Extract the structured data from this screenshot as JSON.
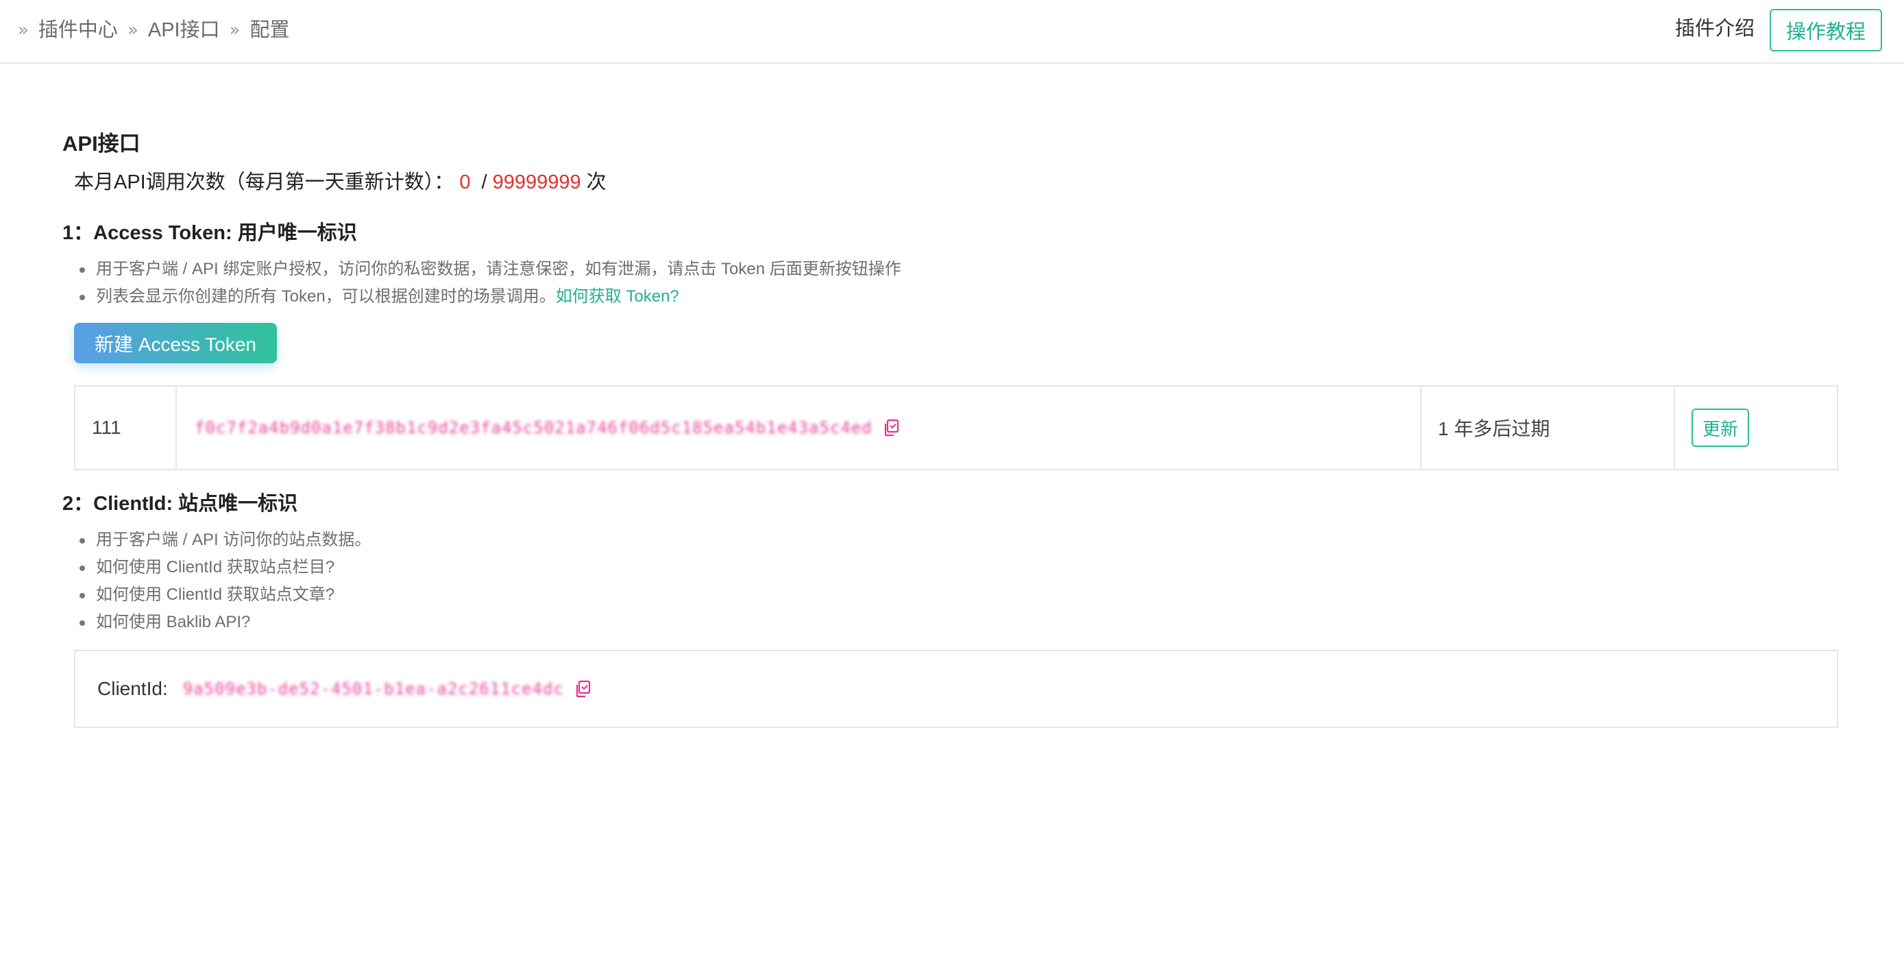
{
  "breadcrumb": {
    "items": [
      "插件中心",
      "API接口",
      "配置"
    ]
  },
  "header": {
    "intro_label": "插件介绍",
    "tutorial_label": "操作教程"
  },
  "page": {
    "title": "API接口",
    "quota": {
      "label": "本月API调用次数（每月第一天重新计数）：",
      "used": "0",
      "separator": "/",
      "limit": "99999999",
      "unit": "次"
    }
  },
  "access_token": {
    "title": "1：Access Token: 用户唯一标识",
    "bullets": [
      "用于客户端 / API 绑定账户授权，访问你的私密数据，请注意保密，如有泄漏，请点击 Token 后面更新按钮操作",
      "列表会显示你创建的所有 Token，可以根据创建时的场景调用。"
    ],
    "how_to_link": "如何获取 Token?",
    "new_button_label": "新建 Access Token",
    "rows": [
      {
        "name": "111",
        "token_masked": "f0c7f2a4b9d0a1e7f38b1c9d2e3fa45c5021a746f06d5c185ea54b1e43a5c4ed",
        "expires": "1 年多后过期",
        "action_label": "更新"
      }
    ]
  },
  "client_id": {
    "title": "2：ClientId: 站点唯一标识",
    "bullets": [
      "用于客户端 / API 访问你的站点数据。",
      "如何使用 ClientId 获取站点栏目?",
      "如何使用 ClientId 获取站点文章?",
      "如何使用 Baklib API?"
    ],
    "label": "ClientId:",
    "value_masked": "9a509e3b-de52-4501-b1ea-a2c2611ce4dc"
  },
  "colors": {
    "accent_green": "#21b08f",
    "quota_red": "#e0322c",
    "token_pink": "#e5318a"
  }
}
